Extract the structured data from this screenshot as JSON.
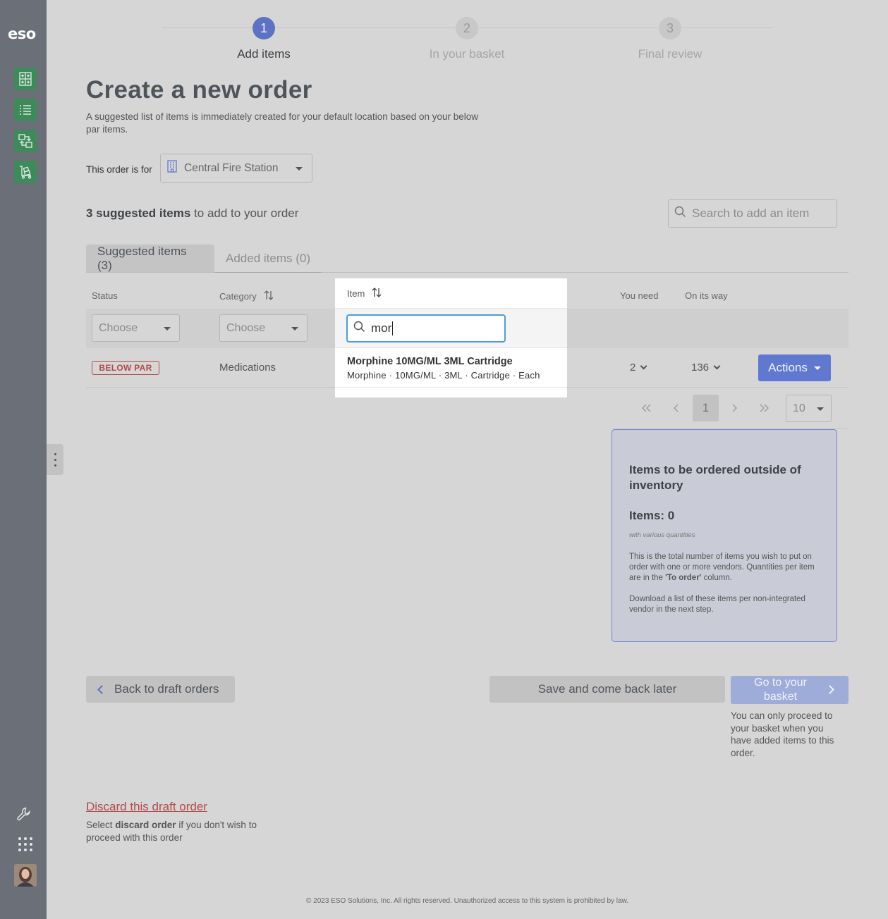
{
  "sidebar": {
    "logo": "eso",
    "nav_icons": [
      "inventory-icon",
      "list-icon",
      "transfer-icon",
      "cart-icon"
    ],
    "bottom_icons": [
      "wrench-icon",
      "apps-grid-icon",
      "avatar"
    ]
  },
  "stepper": {
    "steps": [
      {
        "number": "1",
        "label": "Add items",
        "state": "active"
      },
      {
        "number": "2",
        "label": "In your basket",
        "state": "inactive"
      },
      {
        "number": "3",
        "label": "Final review",
        "state": "inactive"
      }
    ]
  },
  "page": {
    "title": "Create a new order",
    "subtitle": "A suggested list of items is immediately created for your default location based on your below par items.",
    "order_for_label": "This order is for",
    "location": "Central Fire Station"
  },
  "summary": {
    "count_bold": "3 suggested items",
    "count_rest": " to add to your order",
    "search_placeholder": "Search to add an item"
  },
  "tabs": [
    {
      "label": "Suggested items (3)",
      "active": true
    },
    {
      "label": "Added items (0)",
      "active": false
    }
  ],
  "table": {
    "headers": {
      "status": "Status",
      "category": "Category",
      "item": "Item",
      "you_need": "You need",
      "on_its_way": "On its way"
    },
    "filters": {
      "status": "Choose",
      "category": "Choose"
    },
    "item_filter_value": "mor",
    "rows": [
      {
        "status": "BELOW PAR",
        "category": "Medications",
        "item_name": "Morphine 10MG/ML 3ML Cartridge",
        "item_desc": "Morphine · 10MG/ML · 3ML · Cartridge · Each",
        "you_need": "2",
        "on_its_way": "136",
        "actions": "Actions"
      }
    ]
  },
  "pagination": {
    "current_page": "1",
    "page_size": "10"
  },
  "info_card": {
    "title": "Items to be ordered outside of inventory",
    "count": "Items: 0",
    "sub": "with various quantities",
    "p1_before": "This is the total number of items you wish to put on order with one or more vendors. Quantities per item are in the ",
    "p1_bold": "'To order'",
    "p1_after": " column.",
    "p2": "Download a list of these items per non-integrated vendor in the next step."
  },
  "buttons": {
    "back": "Back to draft orders",
    "save": "Save and come back later",
    "go": "Go to your basket",
    "go_note": "You can only proceed to your basket when you have added items to this order."
  },
  "discard": {
    "link": "Discard this draft order",
    "note_before": "Select ",
    "note_bold": "discard order",
    "note_after": " if you don't wish to proceed with this order"
  },
  "footer": "© 2023 ESO Solutions, Inc. All rights reserved. Unauthorized access to this system is prohibited by law.",
  "colors": {
    "sidebar": "#6a6f78",
    "nav_green": "#3f8a5a",
    "accent_blue": "#6078cf",
    "below_par_red": "#b24a4a",
    "focus_blue": "#4a9de0"
  }
}
